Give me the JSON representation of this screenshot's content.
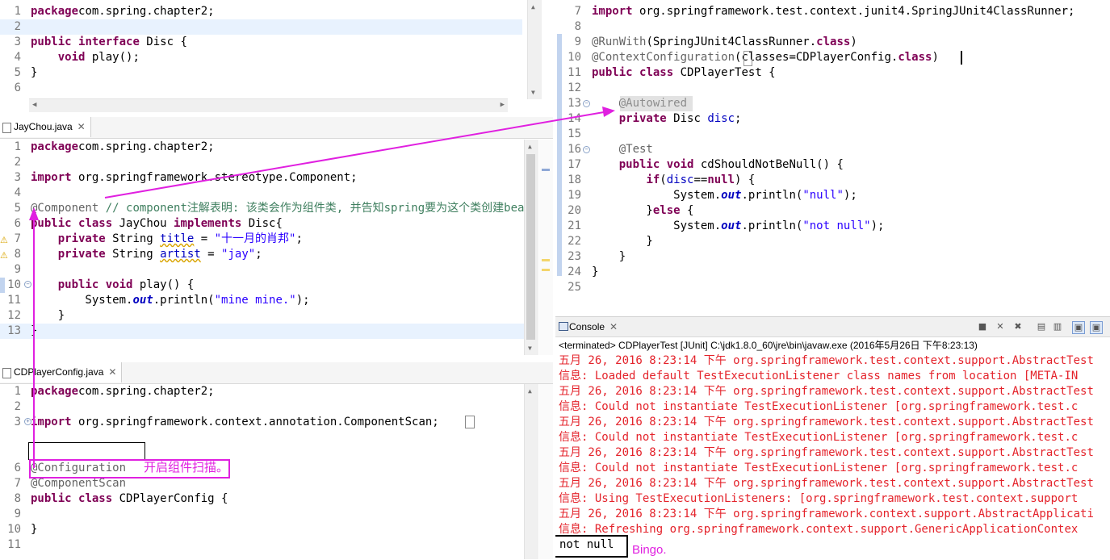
{
  "disc_editor": {
    "lines": [
      {
        "n": "1",
        "t": [
          [
            "kw",
            "package"
          ],
          [
            "",
            "com.spring.chapter2;"
          ]
        ]
      },
      {
        "n": "2",
        "t": []
      },
      {
        "n": "3",
        "t": [
          [
            "kw",
            "public"
          ],
          [
            "",
            " "
          ],
          [
            "kw",
            "interface"
          ],
          [
            "",
            " Disc {"
          ]
        ]
      },
      {
        "n": "4",
        "t": [
          [
            "",
            "    "
          ],
          [
            "kw",
            "void"
          ],
          [
            "",
            " play();"
          ]
        ]
      },
      {
        "n": "5",
        "t": [
          [
            "",
            "}"
          ]
        ]
      },
      {
        "n": "6",
        "t": []
      }
    ]
  },
  "jaychou_editor": {
    "tab_label": "JayChou.java",
    "lines": [
      {
        "n": "1",
        "t": [
          [
            "kw",
            "package"
          ],
          [
            "",
            "com.spring.chapter2;"
          ]
        ]
      },
      {
        "n": "2",
        "t": []
      },
      {
        "n": "3",
        "t": [
          [
            "kw",
            "import"
          ],
          [
            "",
            " org.springframework.stereotype.Component;"
          ]
        ]
      },
      {
        "n": "4",
        "t": []
      },
      {
        "n": "5",
        "t": [
          [
            "ann",
            "@Component"
          ],
          [
            "",
            " "
          ],
          [
            "com",
            "// component注解表明: 该类会作为组件类, 并告知spring要为这个类创建bean."
          ]
        ]
      },
      {
        "n": "6",
        "t": [
          [
            "kw",
            "public"
          ],
          [
            "",
            " "
          ],
          [
            "kw",
            "class"
          ],
          [
            "",
            " JayChou "
          ],
          [
            "kw",
            "implements"
          ],
          [
            "",
            " Disc{"
          ]
        ]
      },
      {
        "n": "7",
        "t": [
          [
            "",
            "    "
          ],
          [
            "kw",
            "private"
          ],
          [
            "",
            " String "
          ],
          [
            "fld",
            "title"
          ],
          [
            "",
            " = "
          ],
          [
            "str",
            "\"十一月的肖邦\""
          ],
          [
            "",
            ";"
          ]
        ]
      },
      {
        "n": "8",
        "t": [
          [
            "",
            "    "
          ],
          [
            "kw",
            "private"
          ],
          [
            "",
            " String "
          ],
          [
            "fld",
            "artist"
          ],
          [
            "",
            " = "
          ],
          [
            "str",
            "\"jay\""
          ],
          [
            "",
            ";"
          ]
        ]
      },
      {
        "n": "9",
        "t": []
      },
      {
        "n": "10",
        "t": [
          [
            "",
            "    "
          ],
          [
            "kw",
            "public"
          ],
          [
            "",
            " "
          ],
          [
            "kw",
            "void"
          ],
          [
            "",
            " play() {"
          ]
        ]
      },
      {
        "n": "11",
        "t": [
          [
            "",
            "        System."
          ],
          [
            "sfld",
            "out"
          ],
          [
            "",
            ".println("
          ],
          [
            "str",
            "\"mine mine.\""
          ],
          [
            "",
            ");"
          ]
        ]
      },
      {
        "n": "12",
        "t": [
          [
            "",
            "    }"
          ]
        ]
      },
      {
        "n": "13",
        "t": [
          [
            "",
            "}"
          ]
        ]
      }
    ]
  },
  "config_editor": {
    "tab_label": "CDPlayerConfig.java",
    "lines": [
      {
        "n": "1",
        "t": [
          [
            "kw",
            "package"
          ],
          [
            "",
            "com.spring.chapter2;"
          ]
        ]
      },
      {
        "n": "2",
        "t": []
      },
      {
        "n": "3",
        "t": [
          [
            "kw",
            "import"
          ],
          [
            "",
            " org.springframework.context.annotation.ComponentScan;"
          ]
        ]
      },
      {
        "n": "6",
        "t": [
          [
            "ann",
            "@Configuration"
          ]
        ]
      },
      {
        "n": "7",
        "t": [
          [
            "ann",
            "@ComponentScan"
          ]
        ]
      },
      {
        "n": "8",
        "t": [
          [
            "kw",
            "public"
          ],
          [
            "",
            " "
          ],
          [
            "kw",
            "class"
          ],
          [
            "",
            " CDPlayerConfig {"
          ]
        ]
      },
      {
        "n": "9",
        "t": []
      },
      {
        "n": "10",
        "t": [
          [
            "",
            "}"
          ]
        ]
      },
      {
        "n": "11",
        "t": []
      }
    ],
    "scan_note": "开启组件扫描。"
  },
  "test_editor": {
    "lines": [
      {
        "n": "7",
        "t": [
          [
            "kw",
            "import"
          ],
          [
            "",
            " org.springframework.test.context.junit4.SpringJUnit4ClassRunner;"
          ]
        ]
      },
      {
        "n": "8",
        "t": []
      },
      {
        "n": "9",
        "t": [
          [
            "ann",
            "@RunWith"
          ],
          [
            "",
            "(SpringJUnit4ClassRunner."
          ],
          [
            "kw",
            "class"
          ],
          [
            "",
            ")"
          ]
        ]
      },
      {
        "n": "10",
        "t": [
          [
            "ann",
            "@ContextConfiguration"
          ],
          [
            "",
            "(classes=CDPlayerConfig."
          ],
          [
            "kw",
            "class"
          ],
          [
            "",
            ")"
          ]
        ]
      },
      {
        "n": "11",
        "t": [
          [
            "kw",
            "public"
          ],
          [
            "",
            " "
          ],
          [
            "kw",
            "class"
          ],
          [
            "",
            " CDPlayerTest {"
          ]
        ]
      },
      {
        "n": "12",
        "t": []
      },
      {
        "n": "13",
        "t": [
          [
            "",
            "    "
          ],
          [
            "ann",
            "@Autowired"
          ]
        ]
      },
      {
        "n": "14",
        "t": [
          [
            "",
            "    "
          ],
          [
            "kw",
            "private"
          ],
          [
            "",
            " Disc "
          ],
          [
            "fld",
            "disc"
          ],
          [
            "",
            ";"
          ]
        ]
      },
      {
        "n": "15",
        "t": []
      },
      {
        "n": "16",
        "t": [
          [
            "",
            "    "
          ],
          [
            "ann",
            "@Test"
          ]
        ]
      },
      {
        "n": "17",
        "t": [
          [
            "",
            "    "
          ],
          [
            "kw",
            "public"
          ],
          [
            "",
            " "
          ],
          [
            "kw",
            "void"
          ],
          [
            "",
            " cdShouldNotBeNull() {"
          ]
        ]
      },
      {
        "n": "18",
        "t": [
          [
            "",
            "        "
          ],
          [
            "kw",
            "if"
          ],
          [
            "",
            "("
          ],
          [
            "fld",
            "disc"
          ],
          [
            "",
            "=="
          ],
          [
            "kw",
            "null"
          ],
          [
            "",
            ") {"
          ]
        ]
      },
      {
        "n": "19",
        "t": [
          [
            "",
            "            System."
          ],
          [
            "sfld",
            "out"
          ],
          [
            "",
            ".println("
          ],
          [
            "str",
            "\"null\""
          ],
          [
            "",
            ");"
          ]
        ]
      },
      {
        "n": "20",
        "t": [
          [
            "",
            "        }"
          ],
          [
            "kw",
            "else"
          ],
          [
            "",
            " {"
          ]
        ]
      },
      {
        "n": "21",
        "t": [
          [
            "",
            "            System."
          ],
          [
            "sfld",
            "out"
          ],
          [
            "",
            ".println("
          ],
          [
            "str",
            "\"not null\""
          ],
          [
            "",
            ");"
          ]
        ]
      },
      {
        "n": "22",
        "t": [
          [
            "",
            "        }"
          ]
        ]
      },
      {
        "n": "23",
        "t": [
          [
            "",
            "    }"
          ]
        ]
      },
      {
        "n": "24",
        "t": [
          [
            "",
            "}"
          ]
        ]
      },
      {
        "n": "25",
        "t": []
      }
    ]
  },
  "console": {
    "tab_label": "Console",
    "status": "<terminated> CDPlayerTest [JUnit] C:\\jdk1.8.0_60\\jre\\bin\\javaw.exe (2016年5月26日 下午8:23:13)",
    "lines": [
      "五月 26, 2016 8:23:14 下午 org.springframework.test.context.support.AbstractTest",
      "信息: Loaded default TestExecutionListener class names from location [META-IN",
      "五月 26, 2016 8:23:14 下午 org.springframework.test.context.support.AbstractTest",
      "信息: Could not instantiate TestExecutionListener [org.springframework.test.c",
      "五月 26, 2016 8:23:14 下午 org.springframework.test.context.support.AbstractTest",
      "信息: Could not instantiate TestExecutionListener [org.springframework.test.c",
      "五月 26, 2016 8:23:14 下午 org.springframework.test.context.support.AbstractTest",
      "信息: Could not instantiate TestExecutionListener [org.springframework.test.c",
      "五月 26, 2016 8:23:14 下午 org.springframework.test.context.support.AbstractTest",
      "信息: Using TestExecutionListeners: [org.springframework.test.context.support",
      "五月 26, 2016 8:23:14 下午 org.springframework.context.support.AbstractApplicati",
      "信息: Refreshing org.springframework.context.support.GenericApplicationContex"
    ],
    "output": "not null",
    "bingo": "Bingo."
  },
  "colors": {
    "keyword": "#7f0055",
    "annotation": "#646464",
    "string": "#2a00ff",
    "field": "#0000c0",
    "comment": "#3f7f5f",
    "console_error": "#e4232b",
    "markup": "#e020e0"
  }
}
